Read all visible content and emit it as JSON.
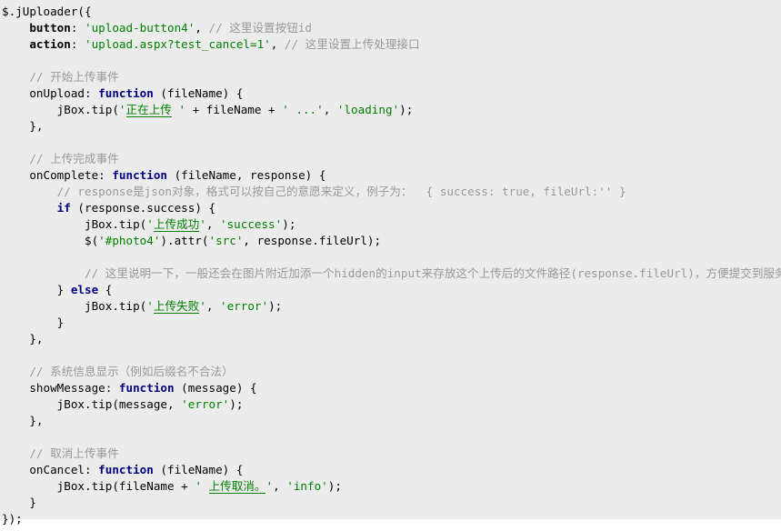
{
  "view": {
    "type": "code-snippet",
    "language": "javascript",
    "background_color": "#ececec",
    "page_background_color": "#ffffff",
    "colors": {
      "text": "#000000",
      "keyword": "#000080",
      "string": "#008000",
      "comment": "#999999",
      "property": "#000000"
    }
  },
  "code": {
    "lines": [
      {
        "n": 1,
        "indent": 0,
        "tokens": [
          {
            "t": "plain",
            "v": "$.jUploader({"
          }
        ]
      },
      {
        "n": 2,
        "indent": 1,
        "tokens": [
          {
            "t": "prop",
            "v": "button"
          },
          {
            "t": "plain",
            "v": ": "
          },
          {
            "t": "str",
            "v": "'upload-button4'"
          },
          {
            "t": "plain",
            "v": ", "
          },
          {
            "t": "cm",
            "v": "// 这里设置按钮id"
          }
        ]
      },
      {
        "n": 3,
        "indent": 1,
        "tokens": [
          {
            "t": "prop",
            "v": "action"
          },
          {
            "t": "plain",
            "v": ": "
          },
          {
            "t": "str",
            "v": "'upload.aspx?test_cancel=1'"
          },
          {
            "t": "plain",
            "v": ", "
          },
          {
            "t": "cm",
            "v": "// 这里设置上传处理接口"
          }
        ]
      },
      {
        "n": 4,
        "indent": 0,
        "tokens": []
      },
      {
        "n": 5,
        "indent": 1,
        "tokens": [
          {
            "t": "cm",
            "v": "// 开始上传事件"
          }
        ]
      },
      {
        "n": 6,
        "indent": 1,
        "tokens": [
          {
            "t": "plain",
            "v": "onUpload: "
          },
          {
            "t": "kw",
            "v": "function"
          },
          {
            "t": "plain",
            "v": " (fileName) {"
          }
        ]
      },
      {
        "n": 7,
        "indent": 2,
        "tokens": [
          {
            "t": "plain",
            "v": "jBox.tip("
          },
          {
            "t": "str",
            "v": "'"
          },
          {
            "t": "str-cn",
            "v": "正在上传"
          },
          {
            "t": "str",
            "v": " '"
          },
          {
            "t": "plain",
            "v": " + fileName + "
          },
          {
            "t": "str",
            "v": "' ...'"
          },
          {
            "t": "plain",
            "v": ", "
          },
          {
            "t": "str",
            "v": "'loading'"
          },
          {
            "t": "plain",
            "v": ");"
          }
        ]
      },
      {
        "n": 8,
        "indent": 1,
        "tokens": [
          {
            "t": "plain",
            "v": "},"
          }
        ]
      },
      {
        "n": 9,
        "indent": 0,
        "tokens": []
      },
      {
        "n": 10,
        "indent": 1,
        "tokens": [
          {
            "t": "cm",
            "v": "// 上传完成事件"
          }
        ]
      },
      {
        "n": 11,
        "indent": 1,
        "tokens": [
          {
            "t": "plain",
            "v": "onComplete: "
          },
          {
            "t": "kw",
            "v": "function"
          },
          {
            "t": "plain",
            "v": " (fileName, response) {"
          }
        ]
      },
      {
        "n": 12,
        "indent": 2,
        "tokens": [
          {
            "t": "cm",
            "v": "// response是json对象，格式可以按自己的意愿来定义，例子为：  { success: true, fileUrl:'' }"
          }
        ]
      },
      {
        "n": 13,
        "indent": 2,
        "tokens": [
          {
            "t": "kw",
            "v": "if"
          },
          {
            "t": "plain",
            "v": " (response.success) {"
          }
        ]
      },
      {
        "n": 14,
        "indent": 3,
        "tokens": [
          {
            "t": "plain",
            "v": "jBox.tip("
          },
          {
            "t": "str",
            "v": "'"
          },
          {
            "t": "str-cn",
            "v": "上传成功"
          },
          {
            "t": "str",
            "v": "'"
          },
          {
            "t": "plain",
            "v": ", "
          },
          {
            "t": "str",
            "v": "'success'"
          },
          {
            "t": "plain",
            "v": ");"
          }
        ]
      },
      {
        "n": 15,
        "indent": 3,
        "tokens": [
          {
            "t": "plain",
            "v": "$("
          },
          {
            "t": "str",
            "v": "'#photo4'"
          },
          {
            "t": "plain",
            "v": ").attr("
          },
          {
            "t": "str",
            "v": "'src'"
          },
          {
            "t": "plain",
            "v": ", response.fileUrl);"
          }
        ]
      },
      {
        "n": 16,
        "indent": 0,
        "tokens": []
      },
      {
        "n": 17,
        "indent": 3,
        "tokens": [
          {
            "t": "cm",
            "v": "// 这里说明一下，一般还会在图片附近加添一个hidden的input来存放这个上传后的文件路径(response.fileUrl)，方便提交到服务器保存"
          }
        ]
      },
      {
        "n": 18,
        "indent": 2,
        "tokens": [
          {
            "t": "plain",
            "v": "} "
          },
          {
            "t": "kw",
            "v": "else"
          },
          {
            "t": "plain",
            "v": " {"
          }
        ]
      },
      {
        "n": 19,
        "indent": 3,
        "tokens": [
          {
            "t": "plain",
            "v": "jBox.tip("
          },
          {
            "t": "str",
            "v": "'"
          },
          {
            "t": "str-cn",
            "v": "上传失败"
          },
          {
            "t": "str",
            "v": "'"
          },
          {
            "t": "plain",
            "v": ", "
          },
          {
            "t": "str",
            "v": "'error'"
          },
          {
            "t": "plain",
            "v": ");"
          }
        ]
      },
      {
        "n": 20,
        "indent": 2,
        "tokens": [
          {
            "t": "plain",
            "v": "}"
          }
        ]
      },
      {
        "n": 21,
        "indent": 1,
        "tokens": [
          {
            "t": "plain",
            "v": "},"
          }
        ]
      },
      {
        "n": 22,
        "indent": 0,
        "tokens": []
      },
      {
        "n": 23,
        "indent": 1,
        "tokens": [
          {
            "t": "cm",
            "v": "// 系统信息显示（例如后缀名不合法）"
          }
        ]
      },
      {
        "n": 24,
        "indent": 1,
        "tokens": [
          {
            "t": "plain",
            "v": "showMessage: "
          },
          {
            "t": "kw",
            "v": "function"
          },
          {
            "t": "plain",
            "v": " (message) {"
          }
        ]
      },
      {
        "n": 25,
        "indent": 2,
        "tokens": [
          {
            "t": "plain",
            "v": "jBox.tip(message, "
          },
          {
            "t": "str",
            "v": "'error'"
          },
          {
            "t": "plain",
            "v": ");"
          }
        ]
      },
      {
        "n": 26,
        "indent": 1,
        "tokens": [
          {
            "t": "plain",
            "v": "},"
          }
        ]
      },
      {
        "n": 27,
        "indent": 0,
        "tokens": []
      },
      {
        "n": 28,
        "indent": 1,
        "tokens": [
          {
            "t": "cm",
            "v": "// 取消上传事件"
          }
        ]
      },
      {
        "n": 29,
        "indent": 1,
        "tokens": [
          {
            "t": "plain",
            "v": "onCancel: "
          },
          {
            "t": "kw",
            "v": "function"
          },
          {
            "t": "plain",
            "v": " (fileName) {"
          }
        ]
      },
      {
        "n": 30,
        "indent": 2,
        "tokens": [
          {
            "t": "plain",
            "v": "jBox.tip(fileName + "
          },
          {
            "t": "str",
            "v": "' "
          },
          {
            "t": "str-cn",
            "v": "上传取消。"
          },
          {
            "t": "str",
            "v": "'"
          },
          {
            "t": "plain",
            "v": ", "
          },
          {
            "t": "str",
            "v": "'info'"
          },
          {
            "t": "plain",
            "v": ");"
          }
        ]
      },
      {
        "n": 31,
        "indent": 1,
        "tokens": [
          {
            "t": "plain",
            "v": "}"
          }
        ]
      },
      {
        "n": 32,
        "indent": 0,
        "tokens": [
          {
            "t": "plain",
            "v": "});"
          }
        ]
      }
    ]
  }
}
